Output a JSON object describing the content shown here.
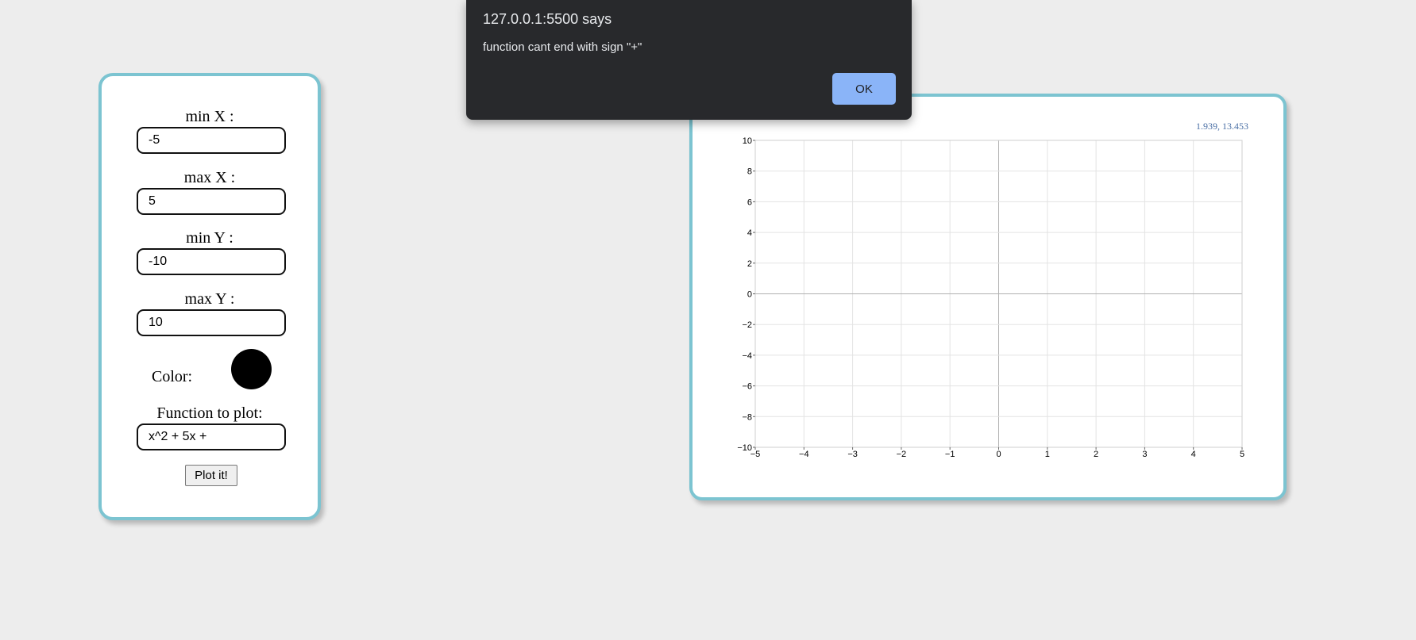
{
  "controls": {
    "min_x": {
      "label": "min X :",
      "value": "-5"
    },
    "max_x": {
      "label": "max X :",
      "value": "5"
    },
    "min_y": {
      "label": "min Y :",
      "value": "-10"
    },
    "max_y": {
      "label": "max Y :",
      "value": "10"
    },
    "color": {
      "label": "Color:",
      "value": "#000000"
    },
    "function": {
      "label": "Function to plot:",
      "value": "x^2 + 5x +"
    },
    "plot_button": "Plot it!"
  },
  "plot": {
    "coord_readout": "1.939, 13.453"
  },
  "alert": {
    "title": "127.0.0.1:5500 says",
    "message": "function cant end with sign \"+\"",
    "ok_label": "OK"
  },
  "chart_data": {
    "type": "line",
    "title": "",
    "xlabel": "",
    "ylabel": "",
    "xlim": [
      -5,
      5
    ],
    "ylim": [
      -10,
      10
    ],
    "x_ticks": [
      "−5",
      "−4",
      "−3",
      "−2",
      "−1",
      "0",
      "1",
      "2",
      "3",
      "4",
      "5"
    ],
    "y_ticks": [
      "10",
      "8",
      "6",
      "4",
      "2",
      "0",
      "−2",
      "−4",
      "−6",
      "−8",
      "−10"
    ],
    "grid": true,
    "series": []
  }
}
